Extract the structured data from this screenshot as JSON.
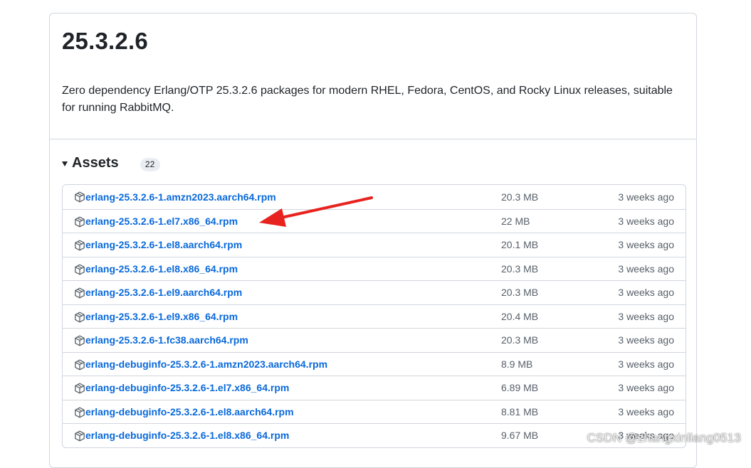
{
  "release": {
    "title": "25.3.2.6",
    "description": "Zero dependency Erlang/OTP 25.3.2.6 packages for modern RHEL, Fedora, CentOS, and Rocky Linux releases, suitable for running RabbitMQ."
  },
  "assets": {
    "heading": "Assets",
    "count": "22",
    "items": [
      {
        "name": "erlang-25.3.2.6-1.amzn2023.aarch64.rpm",
        "size": "20.3 MB",
        "date": "3 weeks ago"
      },
      {
        "name": "erlang-25.3.2.6-1.el7.x86_64.rpm",
        "size": "22 MB",
        "date": "3 weeks ago"
      },
      {
        "name": "erlang-25.3.2.6-1.el8.aarch64.rpm",
        "size": "20.1 MB",
        "date": "3 weeks ago"
      },
      {
        "name": "erlang-25.3.2.6-1.el8.x86_64.rpm",
        "size": "20.3 MB",
        "date": "3 weeks ago"
      },
      {
        "name": "erlang-25.3.2.6-1.el9.aarch64.rpm",
        "size": "20.3 MB",
        "date": "3 weeks ago"
      },
      {
        "name": "erlang-25.3.2.6-1.el9.x86_64.rpm",
        "size": "20.4 MB",
        "date": "3 weeks ago"
      },
      {
        "name": "erlang-25.3.2.6-1.fc38.aarch64.rpm",
        "size": "20.3 MB",
        "date": "3 weeks ago"
      },
      {
        "name": "erlang-debuginfo-25.3.2.6-1.amzn2023.aarch64.rpm",
        "size": "8.9 MB",
        "date": "3 weeks ago"
      },
      {
        "name": "erlang-debuginfo-25.3.2.6-1.el7.x86_64.rpm",
        "size": "6.89 MB",
        "date": "3 weeks ago"
      },
      {
        "name": "erlang-debuginfo-25.3.2.6-1.el8.aarch64.rpm",
        "size": "8.81 MB",
        "date": "3 weeks ago"
      },
      {
        "name": "erlang-debuginfo-25.3.2.6-1.el8.x86_64.rpm",
        "size": "9.67 MB",
        "date": "3 weeks ago"
      }
    ]
  },
  "annotation": {
    "icon": "red-arrow-icon",
    "color": "#e8231f"
  },
  "watermark": {
    "text": "CSDN @zhangxinliang0513"
  },
  "colors": {
    "link": "#0969da",
    "muted": "#57606a",
    "border": "#d0d7de"
  }
}
